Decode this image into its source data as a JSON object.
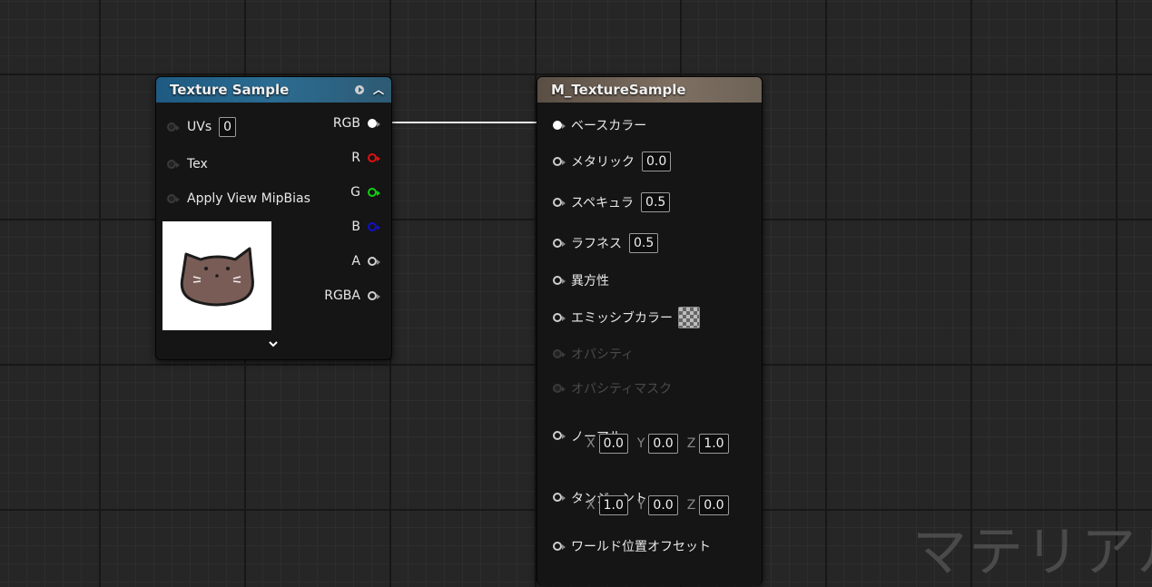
{
  "texture_node": {
    "title": "Texture Sample",
    "inputs": [
      {
        "label": "UVs",
        "value": "0"
      },
      {
        "label": "Tex"
      },
      {
        "label": "Apply View MipBias"
      }
    ],
    "outputs": [
      {
        "label": "RGB",
        "color": "#ffffff"
      },
      {
        "label": "R",
        "color": "#e01010"
      },
      {
        "label": "G",
        "color": "#10d010"
      },
      {
        "label": "B",
        "color": "#1010c8"
      },
      {
        "label": "A",
        "color": "#cfcfcf"
      },
      {
        "label": "RGBA",
        "color": "#cfcfcf"
      }
    ],
    "preview_icon": "cat-face-texture-preview",
    "colors": {
      "header": "#2b6c92"
    }
  },
  "material_node": {
    "title": "M_TextureSample",
    "pins": [
      {
        "label": "ベースカラー"
      },
      {
        "label": "メタリック",
        "value": "0.0"
      },
      {
        "label": "スペキュラ",
        "value": "0.5"
      },
      {
        "label": "ラフネス",
        "value": "0.5"
      },
      {
        "label": "異方性"
      },
      {
        "label": "エミッシブカラー"
      },
      {
        "label": "オパシティ"
      },
      {
        "label": "オパシティマスク"
      },
      {
        "label": "ノーマル",
        "x": "0.0",
        "y": "0.0",
        "z": "1.0"
      },
      {
        "label": "タンジェント",
        "x": "1.0",
        "y": "0.0",
        "z": "0.0"
      },
      {
        "label": "ワールド位置オフセット"
      }
    ],
    "axis_labels": {
      "x": "X",
      "y": "Y",
      "z": "Z"
    },
    "colors": {
      "header": "#7e6f61"
    }
  },
  "watermark": "マテリアル"
}
